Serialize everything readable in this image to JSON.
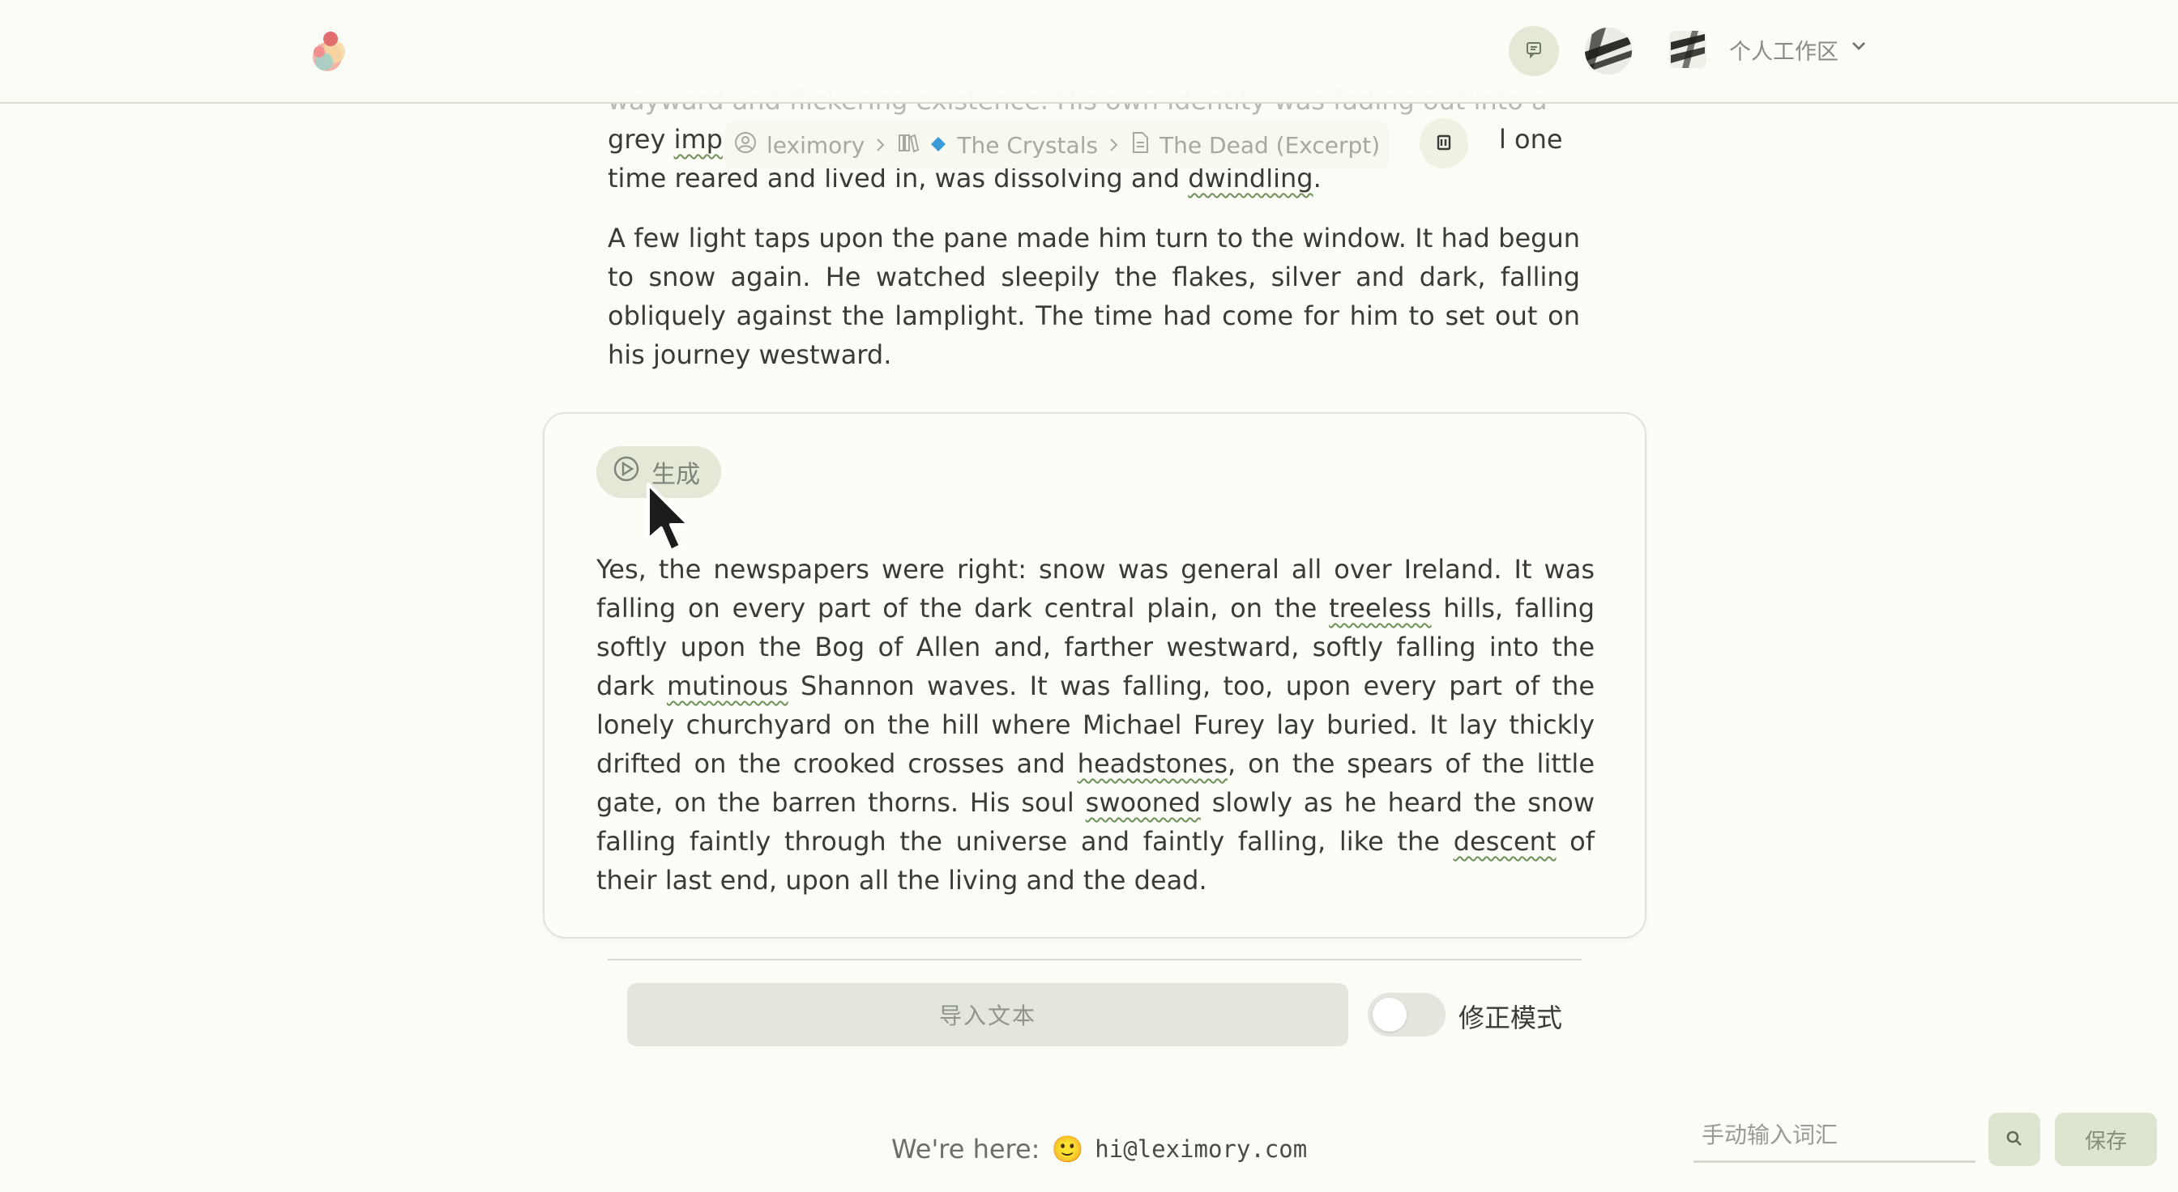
{
  "header": {
    "workspace_label": "个人工作区",
    "icons": {
      "logo": "app-logo",
      "chat": "chat-icon",
      "avatar_primary": "user-avatar",
      "avatar_secondary": "workspace-avatar",
      "workspace_dropdown": "chevron-down-icon"
    }
  },
  "breadcrumb": {
    "items": [
      "leximory",
      "The Crystals",
      "The Dead (Excerpt)"
    ],
    "icons": [
      "user-circle-icon",
      "library-icon",
      "diamond-icon",
      "document-icon"
    ],
    "action_icon": "clipboard-icon"
  },
  "reader": {
    "paragraph1": {
      "line1": "wayward and flickering existence. His own identity was fading out into a",
      "line2_pre": "grey ",
      "line2_word": "imp",
      "line2_post": "l one",
      "line3_pre": "time reared and lived in, was dissolving and ",
      "line3_word": "dwindling",
      "line3_post": "."
    },
    "paragraph2": "A few light taps upon the pane made him turn to the window. It had begun to snow again. He watched sleepily the flakes, silver and dark, falling obliquely against the lamplight. The time had come for him to set out on his journey westward."
  },
  "card": {
    "generate_label": "生成",
    "text": {
      "s1": "Yes, the newspapers were right: snow was general all over Ireland. It was falling on every part of the dark central plain, on the ",
      "w1": "treeless",
      "s2": " hills, falling softly upon the Bog of Allen and, farther westward, softly falling into the dark ",
      "w2": "mutinous",
      "s3": " Shannon waves. It was falling, too, upon every part of the lonely churchyard on the hill where Michael Furey lay buried. It lay thickly drifted on the crooked crosses and ",
      "w3": "headstones",
      "s4": ", on the spears of the little gate, on the barren thorns. His soul ",
      "w4": "swooned",
      "s5": " slowly as he heard the snow falling faintly through the universe and faintly falling, like the ",
      "w5": "descent",
      "s6": " of their last end, upon all the living and the dead."
    }
  },
  "controls": {
    "import_label": "导入文本",
    "fix_mode_label": "修正模式",
    "fix_mode_on": false
  },
  "footer": {
    "prefix": "We're here:",
    "email": "hi@leximory.com",
    "emoji": "🙂"
  },
  "word_entry": {
    "placeholder": "手动输入词汇",
    "value": "",
    "save_label": "保存"
  },
  "colors": {
    "background": "#fbfcf5",
    "accent_soft": "#e3e8d7",
    "underline": "#6f8f58",
    "diamond": "#3b9bd6"
  }
}
